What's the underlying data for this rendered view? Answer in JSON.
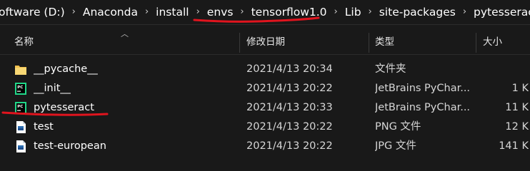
{
  "address_bar": {
    "crumbs": [
      "oftware (D:)",
      "Anaconda",
      "install",
      "envs",
      "tensorflow1.0",
      "Lib",
      "site-packages",
      "pytesseract"
    ],
    "separator": "›"
  },
  "columns": {
    "name": "名称",
    "modified": "修改日期",
    "type": "类型",
    "size": "大小"
  },
  "files": [
    {
      "name": "__pycache__",
      "modified": "2021/4/13 20:34",
      "type": "文件夹",
      "size": "",
      "icon": "folder-icon"
    },
    {
      "name": "__init__",
      "modified": "2021/4/13 20:22",
      "type": "JetBrains PyChar...",
      "size": "1 K",
      "icon": "pycharm-file-icon"
    },
    {
      "name": "pytesseract",
      "modified": "2021/4/13 20:33",
      "type": "JetBrains PyChar...",
      "size": "11 K",
      "icon": "pycharm-file-icon"
    },
    {
      "name": "test",
      "modified": "2021/4/13 20:22",
      "type": "PNG 文件",
      "size": "12 K",
      "icon": "image-file-icon"
    },
    {
      "name": "test-european",
      "modified": "2021/4/13 20:22",
      "type": "JPG 文件",
      "size": "141 K",
      "icon": "image-file-icon"
    }
  ],
  "colors": {
    "background": "#191919",
    "annotation_red": "#e0141e",
    "folder_yellow": "#f2c14e",
    "pycharm_green": "#21d789"
  }
}
